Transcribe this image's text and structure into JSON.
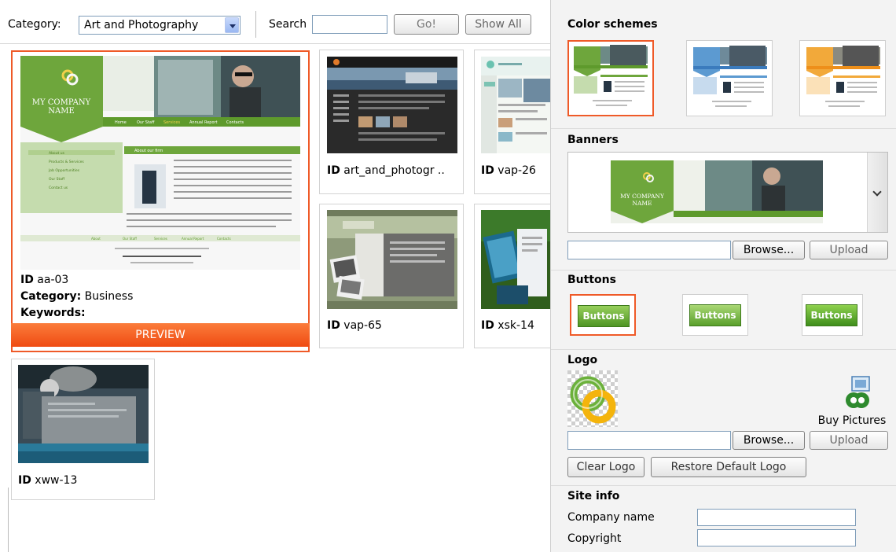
{
  "toolbar": {
    "category_label": "Category:",
    "category_value": "Art and Photography",
    "search_label": "Search",
    "search_value": "",
    "go_label": "Go!",
    "show_all_label": "Show All"
  },
  "templates": [
    {
      "id_label": "ID",
      "id": "aa-03",
      "category_label": "Category:",
      "category": "Business",
      "keywords_label": "Keywords:",
      "keywords": "",
      "selected": true,
      "preview_label": "PREVIEW"
    },
    {
      "id_label": "ID",
      "id": "art_and_photogr .."
    },
    {
      "id_label": "ID",
      "id": "vap-26"
    },
    {
      "id_label": "ID",
      "id": "vap-65"
    },
    {
      "id_label": "ID",
      "id": "xsk-14"
    },
    {
      "id_label": "ID",
      "id": "xww-13"
    }
  ],
  "mockup": {
    "company": "MY COMPANY",
    "name": "NAME",
    "nav": [
      "Home",
      "Our Staff",
      "Services",
      "Annual Report",
      "Contacts"
    ],
    "about": "About our firm",
    "sidebar": [
      "About us",
      "Products & Services",
      "Job Opportunities",
      "Our Staff",
      "Contact us"
    ],
    "footer_links": [
      "About",
      "Our Staff",
      "Services",
      "Annual Report",
      "Contacts"
    ]
  },
  "panel": {
    "color_schemes_title": "Color schemes",
    "banners_title": "Banners",
    "browse_label": "Browse...",
    "upload_label": "Upload",
    "buttons_title": "Buttons",
    "button_sample": "Buttons",
    "logo_title": "Logo",
    "buy_pictures": "Buy Pictures",
    "clear_logo": "Clear Logo",
    "restore_logo": "Restore Default Logo",
    "site_info_title": "Site info",
    "company_name_label": "Company name",
    "copyright_label": "Copyright",
    "company_name_value": "",
    "copyright_value": ""
  },
  "colors": {
    "accent": "#ef5a28",
    "green": "#6aa23a",
    "preview_bar": "#f35a1f"
  }
}
